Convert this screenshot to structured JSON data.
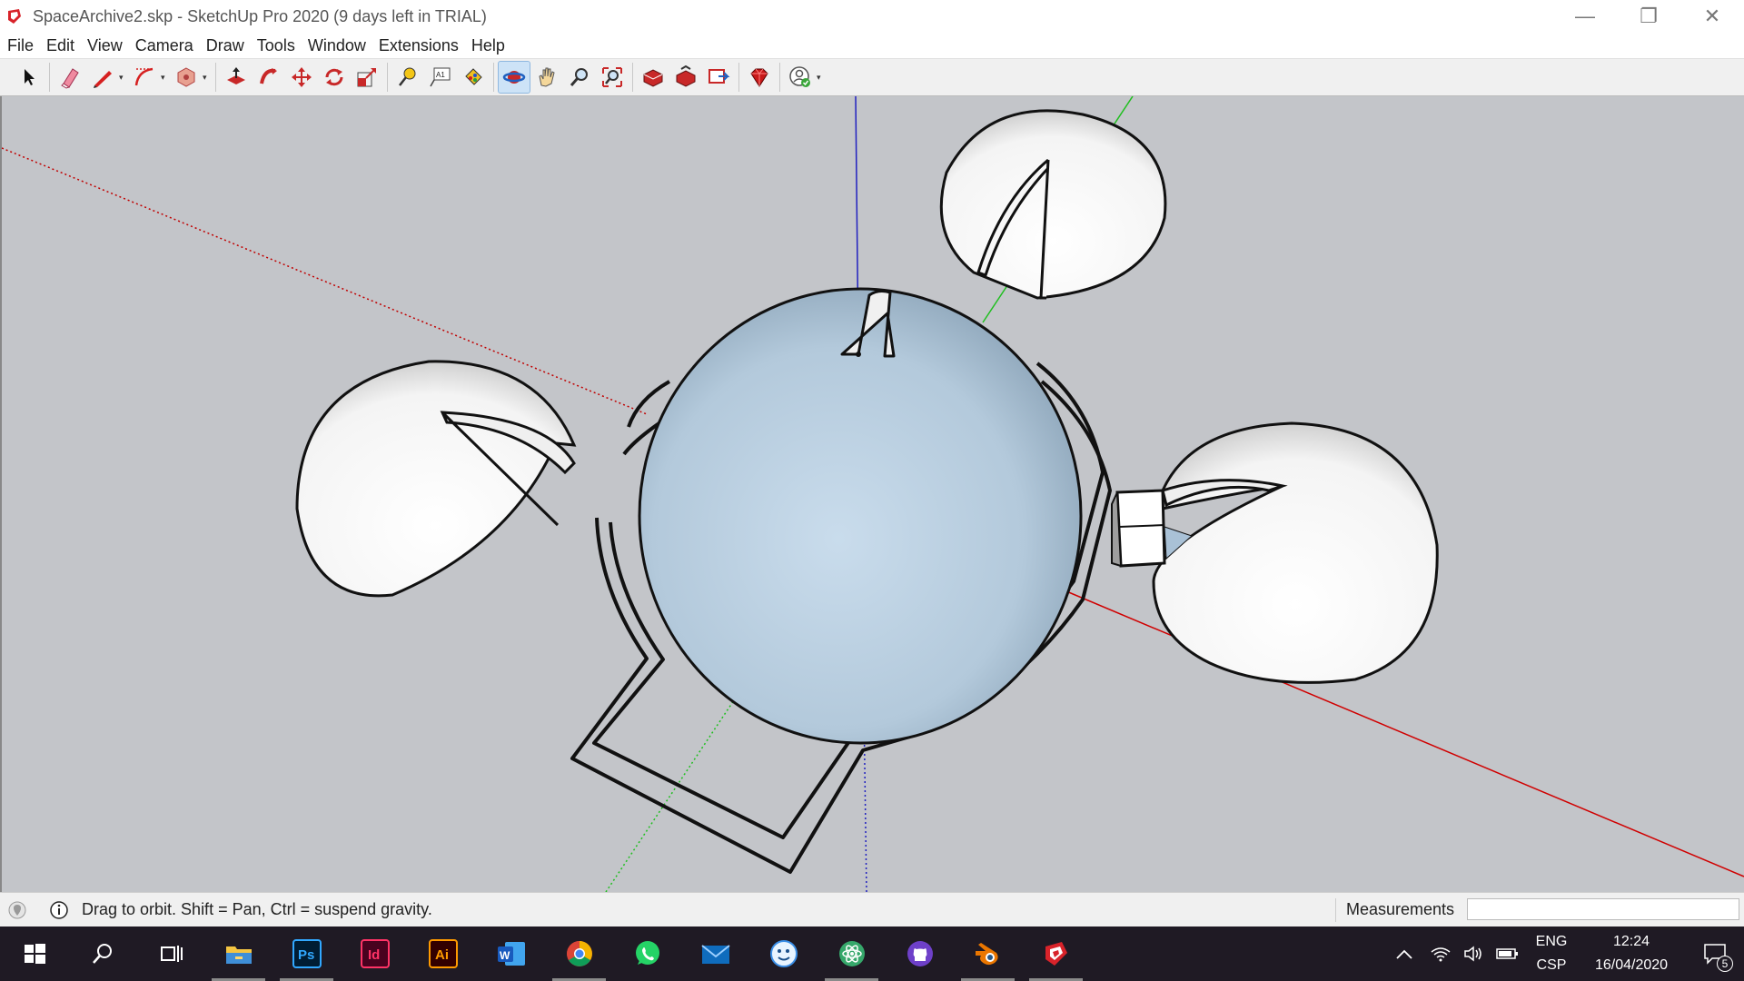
{
  "window": {
    "title": "SpaceArchive2.skp - SketchUp Pro 2020 (9 days left in TRIAL)",
    "minimize_glyph": "—",
    "restore_glyph": "❐",
    "close_glyph": "✕"
  },
  "menu": [
    "File",
    "Edit",
    "View",
    "Camera",
    "Draw",
    "Tools",
    "Window",
    "Extensions",
    "Help"
  ],
  "toolbar": {
    "tools": [
      "select-icon",
      "eraser-icon",
      "pencil-icon",
      "arc-icon",
      "shape-icon",
      "push-pull-icon",
      "follow-me-icon",
      "move-icon",
      "rotate-icon",
      "scale-icon",
      "tape-measure-icon",
      "text-icon",
      "paint-bucket-icon",
      "orbit-icon",
      "pan-icon",
      "zoom-icon",
      "zoom-extents-icon",
      "warehouse-icon",
      "extension-warehouse-icon",
      "layout-icon",
      "ruby-icon",
      "account-icon"
    ],
    "active_tool": "orbit-icon",
    "text_tool_label": "A1"
  },
  "status": {
    "message": "Drag to orbit. Shift = Pan, Ctrl = suspend gravity.",
    "measurements_label": "Measurements",
    "measurements_value": ""
  },
  "taskbar": {
    "apps": [
      "windows-start-icon",
      "search-icon",
      "task-view-icon",
      "file-explorer-icon",
      "photoshop-icon",
      "indesign-icon",
      "illustrator-icon",
      "word-icon",
      "chrome-icon",
      "whatsapp-icon",
      "mail-icon",
      "finder-face-icon",
      "atom-icon",
      "github-icon",
      "blender-icon",
      "sketchup-icon"
    ],
    "labels": {
      "ps": "Ps",
      "id": "Id",
      "ai": "Ai",
      "w": "W"
    },
    "language_top": "ENG",
    "language_bottom": "CSP",
    "time": "12:24",
    "date": "16/04/2020",
    "notifications_count": "5"
  },
  "colors": {
    "viewport_bg": "#c3c5c9",
    "red_axis": "#d00000",
    "green_axis": "#1fbf1f",
    "blue_axis": "#2020c0",
    "dome_fill": "#b8cfe0",
    "taskbar_bg": "#1f1a24"
  }
}
